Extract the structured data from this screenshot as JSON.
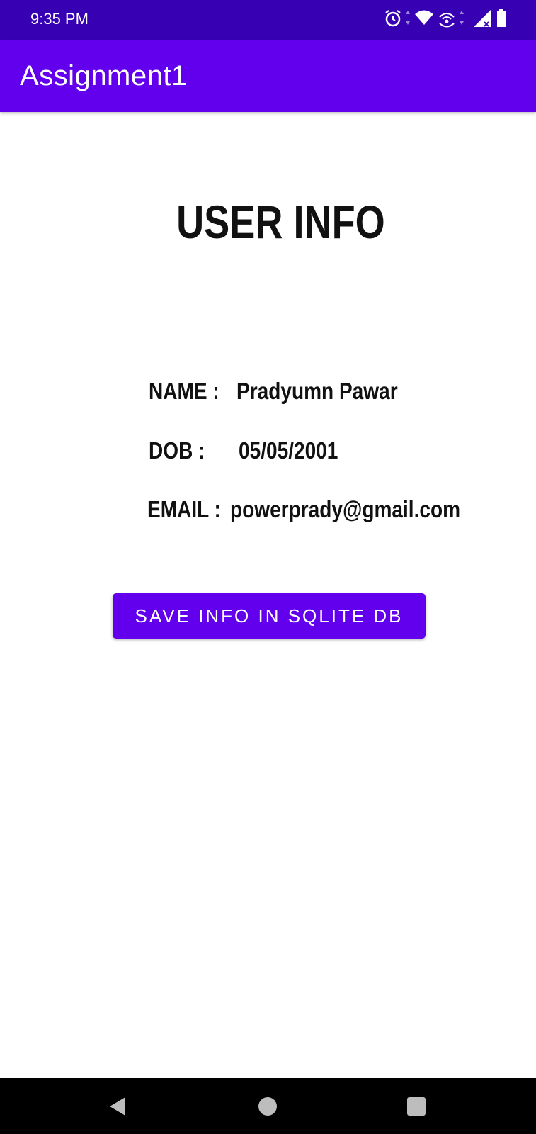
{
  "status_bar": {
    "time": "9:35 PM",
    "icons": [
      "alarm-icon",
      "wifi-icon",
      "hotspot-icon",
      "signal-icon",
      "battery-icon"
    ]
  },
  "app_bar": {
    "title": "Assignment1"
  },
  "content": {
    "heading": "USER INFO",
    "name_label": "NAME :",
    "name_value": "Pradyumn Pawar",
    "dob_label": "DOB :",
    "dob_value": "05/05/2001",
    "email_label": "EMAIL :",
    "email_value": "powerprady@gmail.com",
    "save_button_label": "SAVE INFO IN SQLITE DB"
  },
  "nav_bar": {
    "buttons": [
      "back-icon",
      "home-icon",
      "recents-icon"
    ]
  },
  "colors": {
    "status_bar": "#3700b3",
    "primary": "#6200ee",
    "text": "#111111",
    "background": "#ffffff"
  }
}
